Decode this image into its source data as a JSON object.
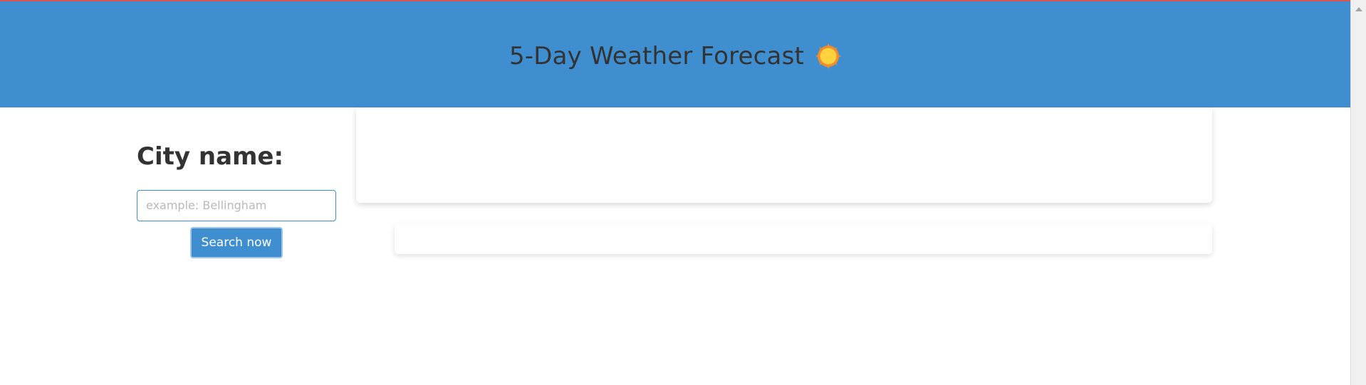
{
  "header": {
    "title": "5-Day Weather Forecast",
    "icon": "sun-icon",
    "background_color": "#3f8fd0"
  },
  "search": {
    "label": "City name:",
    "placeholder": "example: Bellingham",
    "value": "",
    "button_label": "Search now"
  },
  "colors": {
    "accent": "#3f8fd0",
    "top_strip": "#d9534f",
    "text": "#333333",
    "sun_fill": "#ffd23f",
    "sun_rays": "#f08c2a"
  }
}
